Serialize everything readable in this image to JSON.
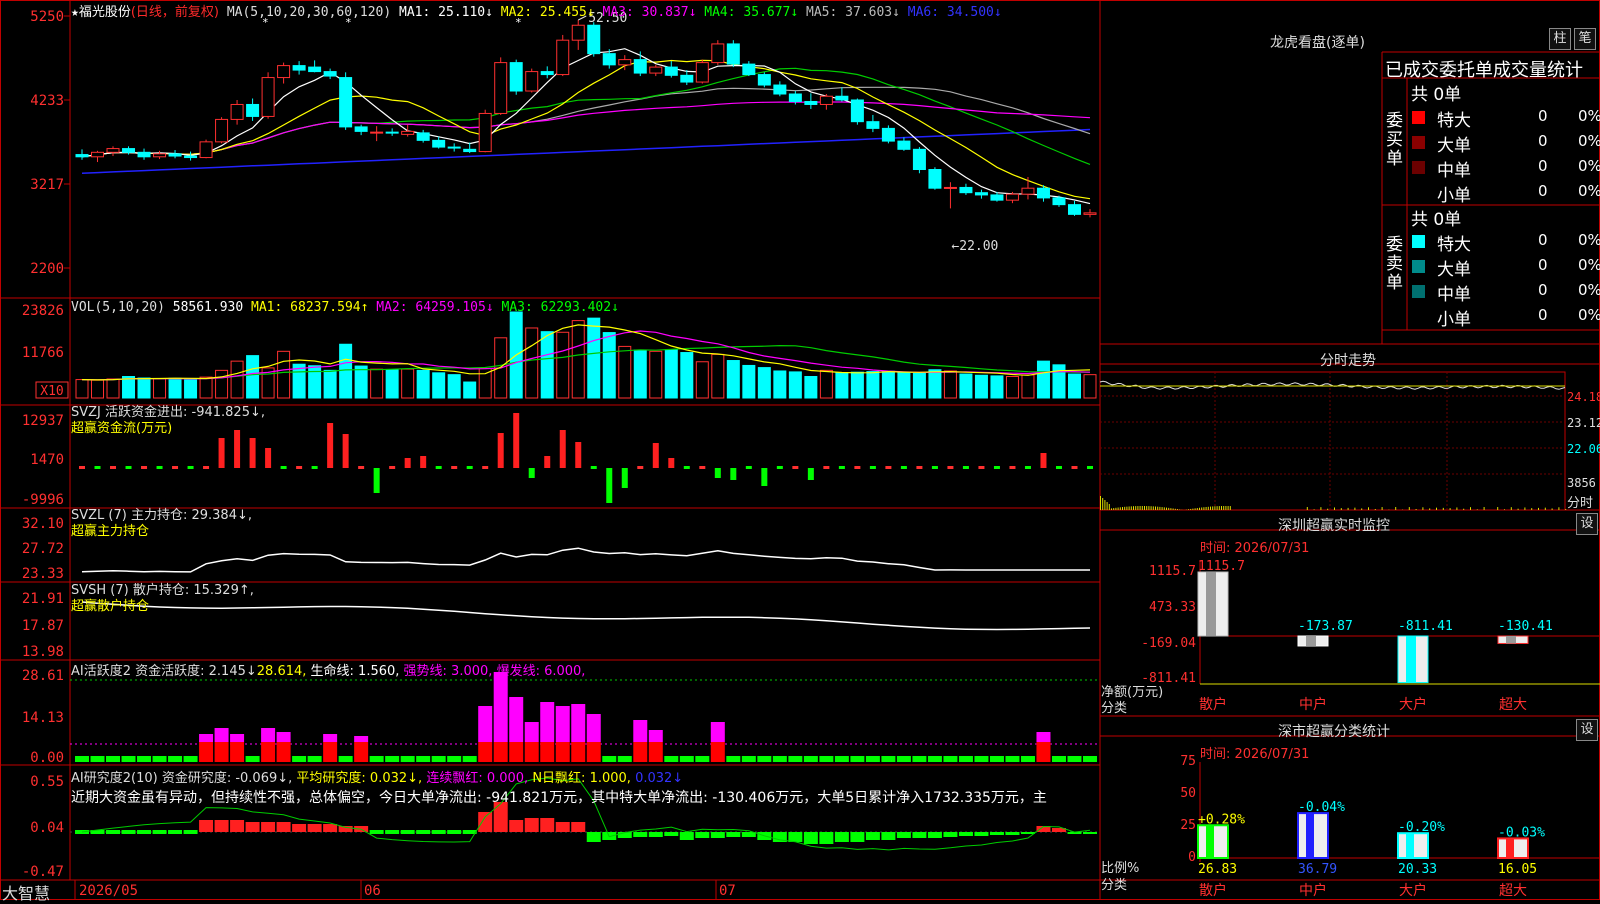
{
  "header": {
    "title": "福光股份",
    "period": "(日线，前复权)",
    "ma_spec": "MA(5,10,20,30,60,120)",
    "ma": [
      {
        "label": "MA1:",
        "value": "25.110",
        "arrow": "↓",
        "color": "#ffffff"
      },
      {
        "label": "MA2:",
        "value": "25.455",
        "arrow": "↓",
        "color": "#ffff00"
      },
      {
        "label": "MA3:",
        "value": "30.837",
        "arrow": "↓",
        "color": "#ff00ff"
      },
      {
        "label": "MA4:",
        "value": "35.677",
        "arrow": "↓",
        "color": "#00ff00"
      },
      {
        "label": "MA5:",
        "value": "37.603",
        "arrow": "↓",
        "color": "#bbbbbb"
      },
      {
        "label": "MA6:",
        "value": "34.500",
        "arrow": "↓",
        "color": "#3333ff"
      }
    ]
  },
  "price_axis": [
    "5250",
    "4233",
    "3217",
    "2200"
  ],
  "price_annotations": {
    "high": "52.50",
    "low": "←22.00"
  },
  "vol": {
    "label": "VOL(5,10,20)",
    "value": "58561.930",
    "ma": [
      {
        "label": "MA1:",
        "value": "68237.594",
        "arrow": "↑",
        "color": "#ffff00"
      },
      {
        "label": "MA2:",
        "value": "64259.105",
        "arrow": "↓",
        "color": "#ff00ff"
      },
      {
        "label": "MA3:",
        "value": "62293.402",
        "arrow": "↓",
        "color": "#00ff00"
      }
    ],
    "axis": [
      "23826",
      "11766"
    ],
    "unit": "X10"
  },
  "svzj": {
    "label": "SVZJ  活跃资金进出: -941.825↓,",
    "sub": "超赢资金流(万元)",
    "axis": [
      "12937",
      "1470",
      "-9996"
    ]
  },
  "svzl": {
    "label": "SVZL  (7) 主力持仓: 29.384↓,",
    "sub": "超赢主力持仓",
    "axis": [
      "32.10",
      "27.72",
      "23.33"
    ]
  },
  "svsh": {
    "label": "SVSH  (7) 散户持仓: 15.329↑,",
    "sub": "超赢散户持仓",
    "axis": [
      "21.91",
      "17.87",
      "13.98"
    ]
  },
  "ai_active": {
    "label": "AI活跃度2 资金活跃度: 2.145↓",
    "v2": "28.614,",
    "v3": "生命线: 1.560,",
    "v4": "强势线: 3.000,",
    "v5": "爆发线: 6.000,",
    "axis": [
      "28.61",
      "14.13",
      "0.00"
    ]
  },
  "ai_research": {
    "label": "AI研究度2(10) 资金研究度: -0.069↓,",
    "v2": "平均研究度: 0.032↓,",
    "v3": "连续飘红: 0.000,",
    "v4": "N日飘红: 1.000,",
    "v5": "0.032↓",
    "comment": "近期大资金虽有异动，但持续性不强，总体偏空，今日大单净流出: -941.821万元，其中特大单净流出: -130.406万元，大单5日累计净入1732.335万元，主",
    "axis": [
      "0.55",
      "0.04",
      "-0.47"
    ]
  },
  "date_axis": [
    "2026/05",
    "06",
    "07"
  ],
  "brand": "大智慧",
  "right": {
    "title": "龙虎看盘(逐单)",
    "btn1": "柱",
    "btn2": "笔",
    "header": "已成交委托单成交量统计",
    "buy_label": "委买单",
    "sell_label": "委卖单",
    "buy_total": "共 0单",
    "sell_total": "共 0单",
    "buy_rows": [
      {
        "name": "特大",
        "count": "0",
        "pct": "0%",
        "color": "#ff0000"
      },
      {
        "name": "大单",
        "count": "0",
        "pct": "0%",
        "color": "#8b0000"
      },
      {
        "name": "中单",
        "count": "0",
        "pct": "0%",
        "color": "#6b0000"
      },
      {
        "name": "小单",
        "count": "0",
        "pct": "0%",
        "color": "#000000"
      }
    ],
    "sell_rows": [
      {
        "name": "特大",
        "count": "0",
        "pct": "0%",
        "color": "#00ffff"
      },
      {
        "name": "大单",
        "count": "0",
        "pct": "0%",
        "color": "#008b8b"
      },
      {
        "name": "中单",
        "count": "0",
        "pct": "0%",
        "color": "#007070"
      },
      {
        "name": "小单",
        "count": "0",
        "pct": "0%",
        "color": "#000000"
      }
    ],
    "intraday": {
      "title": "分时走势",
      "axis": [
        "24.18",
        "23.12",
        "22.06"
      ],
      "vol": "3856",
      "vol_unit": "分时"
    },
    "monitor": {
      "title": "深圳超赢实时监控",
      "btn": "设",
      "time": "时间: 2026/07/31",
      "axis": [
        "1115.7",
        "473.33",
        "-169.04",
        "-811.41"
      ],
      "ylabel": "净额(万元)",
      "xlabel": "分类",
      "categories": [
        "散户",
        "中户",
        "大户",
        "超大"
      ],
      "value_labels": [
        "1115.7",
        "-173.87",
        "-811.41",
        "-130.41"
      ]
    },
    "classify": {
      "title": "深市超赢分类统计",
      "btn": "设",
      "time": "时间: 2026/07/31",
      "axis": [
        "75",
        "50",
        "25",
        "0"
      ],
      "ylabel": "比例%",
      "xlabel": "分类",
      "categories": [
        "散户",
        "中户",
        "大户",
        "超大"
      ],
      "change_labels": [
        "+0.28%",
        "-0.04%",
        "-0.20%",
        "-0.03%"
      ],
      "value_labels": [
        "26.83",
        "36.79",
        "20.33",
        "16.05"
      ]
    }
  },
  "chart_data": [
    {
      "type": "candlestick",
      "title": "福光股份 (日线，前复权)",
      "ylim": [
        22.0,
        52.5
      ],
      "ohlc": [
        [
          34.5,
          35.2,
          33.8,
          34.2
        ],
        [
          34.2,
          35.0,
          33.5,
          34.8
        ],
        [
          34.8,
          35.6,
          34.3,
          35.3
        ],
        [
          35.3,
          35.6,
          34.5,
          34.8
        ],
        [
          34.8,
          35.3,
          33.8,
          34.2
        ],
        [
          34.2,
          35.0,
          33.9,
          34.6
        ],
        [
          34.6,
          35.1,
          34.0,
          34.3
        ],
        [
          34.3,
          34.9,
          33.7,
          34.1
        ],
        [
          34.1,
          36.5,
          34.0,
          36.2
        ],
        [
          36.2,
          39.5,
          36.0,
          39.2
        ],
        [
          39.2,
          41.8,
          38.5,
          41.2
        ],
        [
          41.2,
          42.0,
          39.0,
          39.6
        ],
        [
          39.6,
          45.5,
          39.3,
          44.8
        ],
        [
          44.8,
          46.8,
          44.0,
          46.4
        ],
        [
          46.4,
          47.0,
          45.2,
          45.8
        ],
        [
          46.2,
          47.1,
          45.5,
          45.6
        ],
        [
          45.6,
          46.0,
          44.6,
          45.0
        ],
        [
          44.8,
          45.5,
          37.8,
          38.2
        ],
        [
          38.2,
          38.5,
          37.1,
          37.6
        ],
        [
          37.4,
          38.3,
          36.3,
          37.5
        ],
        [
          37.5,
          38.0,
          37.0,
          37.4
        ],
        [
          37.2,
          38.5,
          36.9,
          37.6
        ],
        [
          37.4,
          37.8,
          36.1,
          36.4
        ],
        [
          36.4,
          36.9,
          35.3,
          35.5
        ],
        [
          35.5,
          36.0,
          34.9,
          35.4
        ],
        [
          35.2,
          36.1,
          34.7,
          34.9
        ],
        [
          34.9,
          40.5,
          34.8,
          40.0
        ],
        [
          40.0,
          47.5,
          39.8,
          46.8
        ],
        [
          46.8,
          47.2,
          42.5,
          43.0
        ],
        [
          43.0,
          46.0,
          42.8,
          45.6
        ],
        [
          45.6,
          46.3,
          44.7,
          45.2
        ],
        [
          45.2,
          50.5,
          45.0,
          49.8
        ],
        [
          49.8,
          52.5,
          48.5,
          51.8
        ],
        [
          51.8,
          52.2,
          47.6,
          48.0
        ],
        [
          48.0,
          48.6,
          46.0,
          46.5
        ],
        [
          46.5,
          47.8,
          45.8,
          47.2
        ],
        [
          47.2,
          48.3,
          45.0,
          45.4
        ],
        [
          45.4,
          46.5,
          45.0,
          46.2
        ],
        [
          46.2,
          47.0,
          44.8,
          45.1
        ],
        [
          45.1,
          45.8,
          43.8,
          44.2
        ],
        [
          44.2,
          47.2,
          44.0,
          46.8
        ],
        [
          46.8,
          49.8,
          46.5,
          49.3
        ],
        [
          49.3,
          49.8,
          46.2,
          46.6
        ],
        [
          46.6,
          47.0,
          45.0,
          45.2
        ],
        [
          45.2,
          45.5,
          43.5,
          43.8
        ],
        [
          43.8,
          44.3,
          42.3,
          42.6
        ],
        [
          42.6,
          43.0,
          41.2,
          41.6
        ],
        [
          41.6,
          42.7,
          40.6,
          41.2
        ],
        [
          41.2,
          42.6,
          40.5,
          42.3
        ],
        [
          42.3,
          43.5,
          41.6,
          41.8
        ],
        [
          41.8,
          42.0,
          38.5,
          38.9
        ],
        [
          38.9,
          39.8,
          37.5,
          38.0
        ],
        [
          38.0,
          38.4,
          36.0,
          36.3
        ],
        [
          36.3,
          36.8,
          35.0,
          35.2
        ],
        [
          35.2,
          35.5,
          32.0,
          32.5
        ],
        [
          32.5,
          32.8,
          29.8,
          30.0
        ],
        [
          30.0,
          30.8,
          27.3,
          30.1
        ],
        [
          30.1,
          30.6,
          29.1,
          29.4
        ],
        [
          29.4,
          29.8,
          28.6,
          29.1
        ],
        [
          29.1,
          29.5,
          28.2,
          28.4
        ],
        [
          28.4,
          29.5,
          28.0,
          29.2
        ],
        [
          29.2,
          31.5,
          28.5,
          30.0
        ],
        [
          30.0,
          30.4,
          28.2,
          28.7
        ],
        [
          28.7,
          29.0,
          27.5,
          27.8
        ],
        [
          27.8,
          28.3,
          26.3,
          26.5
        ],
        [
          26.5,
          27.2,
          26.1,
          26.7
        ]
      ]
    },
    {
      "type": "bar",
      "title": "VOL(5,10,20)",
      "ylim": [
        0,
        28000
      ],
      "values": [
        6000,
        5800,
        6200,
        7000,
        6500,
        6200,
        6400,
        5900,
        6800,
        9000,
        12000,
        13800,
        9800,
        15200,
        11000,
        10500,
        9000,
        17500,
        10400,
        9400,
        9200,
        9400,
        9000,
        8200,
        7600,
        5200,
        9600,
        19600,
        28000,
        22800,
        21600,
        21400,
        25200,
        26000,
        21300,
        16800,
        15600,
        15200,
        15700,
        14800,
        11800,
        14200,
        12200,
        10600,
        9900,
        8800,
        8500,
        7000,
        9000,
        8200,
        8400,
        8600,
        8700,
        8200,
        8000,
        9200,
        8800,
        7800,
        7400,
        7200,
        7000,
        7500,
        12000,
        10800,
        7800,
        7600
      ],
      "up": [
        true,
        true,
        true,
        false,
        false,
        true,
        false,
        false,
        true,
        true,
        true,
        false,
        true,
        true,
        false,
        false,
        false,
        false,
        false,
        true,
        false,
        true,
        false,
        false,
        false,
        false,
        true,
        true,
        false,
        true,
        false,
        true,
        true,
        false,
        false,
        true,
        false,
        true,
        false,
        false,
        true,
        true,
        false,
        false,
        false,
        false,
        false,
        false,
        true,
        false,
        false,
        false,
        false,
        false,
        false,
        false,
        true,
        false,
        false,
        false,
        true,
        true,
        false,
        false,
        false,
        true
      ]
    }
  ]
}
